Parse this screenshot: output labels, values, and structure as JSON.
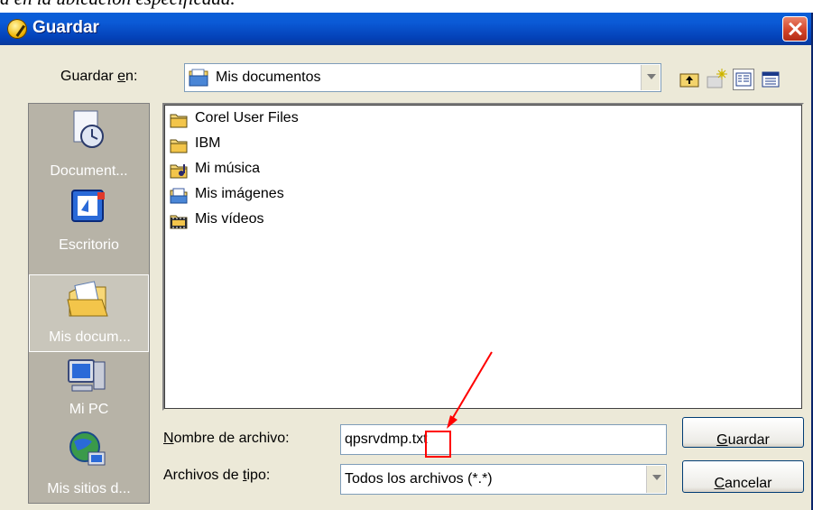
{
  "background_text": "a en la ubicación especificada.",
  "title": "Guardar",
  "save_in": {
    "label_before": "Guardar ",
    "label_accel": "e",
    "label_after": "n:",
    "value": "Mis documentos",
    "icon": "my-documents-icon"
  },
  "toolbar": {
    "icons": [
      "up-one-level-icon",
      "new-folder-icon",
      "list-view-icon",
      "details-view-icon"
    ]
  },
  "places": [
    {
      "label": "Document...",
      "icon": "recent-documents-icon"
    },
    {
      "label": "Escritorio",
      "icon": "desktop-icon"
    },
    {
      "label": "Mis docum...",
      "icon": "my-documents-folder-icon",
      "selected": true
    },
    {
      "label": "Mi PC",
      "icon": "my-computer-icon"
    },
    {
      "label": "Mis sitios d...",
      "icon": "network-places-icon"
    }
  ],
  "files": [
    {
      "name": "Corel User Files",
      "icon": "folder-icon"
    },
    {
      "name": "IBM",
      "icon": "folder-icon"
    },
    {
      "name": "Mi música",
      "icon": "music-folder-icon"
    },
    {
      "name": "Mis imágenes",
      "icon": "pictures-folder-icon"
    },
    {
      "name": "Mis vídeos",
      "icon": "videos-folder-icon"
    }
  ],
  "filename": {
    "label_accel": "N",
    "label_rest": "ombre de archivo:",
    "value": "qpsrvdmp.txt"
  },
  "filetype": {
    "label_before": "Archivos de ",
    "label_accel": "t",
    "label_after": "ipo:",
    "value": "Todos los archivos (*.*)"
  },
  "buttons": {
    "save": {
      "accel": "G",
      "rest": "uardar"
    },
    "cancel": {
      "accel": "C",
      "rest": "ancelar"
    }
  },
  "colors": {
    "titlebar": "#0a5fd8",
    "dialog_bg": "#ece9d8",
    "places_bg": "#b7b3a7",
    "annotation": "#ff0000"
  }
}
